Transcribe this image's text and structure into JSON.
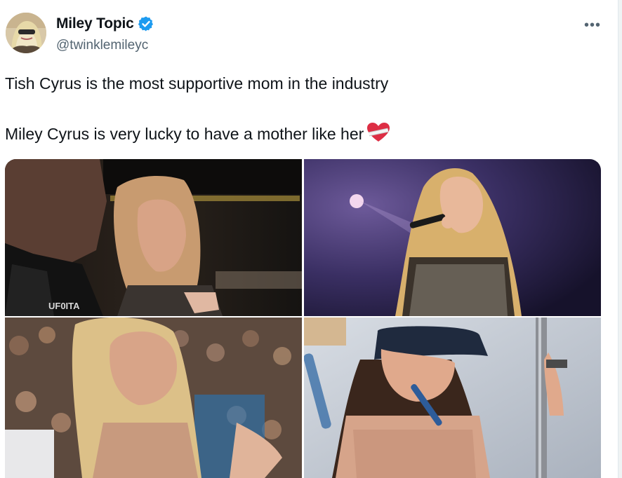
{
  "author": {
    "display_name": "Miley Topic",
    "handle": "@twinklemileyc",
    "avatar_icon": "avatar-portrait",
    "verified_icon": "verified-badge-icon",
    "verified_color": "#1d9bf0"
  },
  "menu": {
    "more_label": "•••"
  },
  "tweet": {
    "line1": "Tish Cyrus is the most supportive mom in the industry",
    "line2": "Miley Cyrus is very lucky to have a mother like her",
    "emoji_icon": "mending-heart-emoji"
  },
  "media": {
    "photos": [
      {
        "id": "photo-1",
        "caption_visible": "",
        "overlay_text": "UF0ITA"
      },
      {
        "id": "photo-2"
      },
      {
        "id": "photo-3"
      },
      {
        "id": "photo-4"
      }
    ]
  },
  "colors": {
    "text_primary": "#0f1419",
    "text_secondary": "#536471",
    "accent": "#1d9bf0"
  }
}
